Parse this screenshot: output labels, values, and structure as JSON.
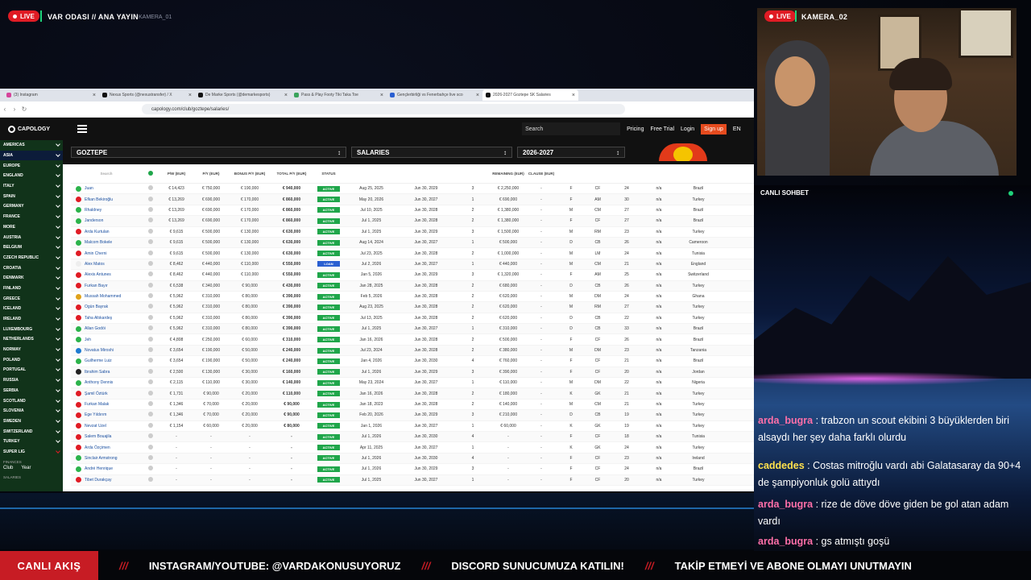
{
  "header": {
    "live": "LIVE",
    "title": "VAR ODASI // ANA YAYIN",
    "sub": "KAMERA_01"
  },
  "cam": {
    "live": "LIVE",
    "title": "KAMERA_02"
  },
  "browser": {
    "tabs": [
      {
        "label": "(3) Instagram",
        "color": "#d6449b"
      },
      {
        "label": "Nexus Sports (@nexustransfer) / X",
        "color": "#111"
      },
      {
        "label": "De Marke Sports (@demarkesports)",
        "color": "#111"
      },
      {
        "label": "Pass & Play Footy Tiki Taka Toe",
        "color": "#3aa35c"
      },
      {
        "label": "Gençlerbirliği vs Fenerbahçe live sco",
        "color": "#2a5fd1"
      },
      {
        "label": "2026-2027 Goztepe SK Salaries",
        "color": "#111"
      }
    ],
    "url": "capology.com/club/goztepe/salaries/"
  },
  "site": {
    "logo": "CAPOLOGY",
    "search": "Search",
    "nav": [
      "Pricing",
      "Free Trial",
      "Login"
    ],
    "signup": "Sign up",
    "lang": "EN"
  },
  "side": {
    "regions": [
      "AMERICAS",
      "ASIA",
      "EUROPE",
      "ENGLAND",
      "ITALY",
      "SPAIN",
      "GERMANY",
      "FRANCE",
      "MORE",
      "AUSTRIA",
      "BELGIUM",
      "CZECH REPUBLIC",
      "CROATIA",
      "DENMARK",
      "FINLAND",
      "GREECE",
      "ICELAND",
      "IRELAND",
      "LUXEMBOURG",
      "NETHERLANDS",
      "NORWAY",
      "POLAND",
      "PORTUGAL",
      "RUSSIA",
      "SERBIA",
      "SCOTLAND",
      "SLOVENIA",
      "SWEDEN",
      "SWITZERLAND",
      "TURKEY",
      "SUPER LIG"
    ],
    "finances": "FINANCES",
    "club": "Club",
    "year": "Year",
    "salaries": "SALARIES"
  },
  "filters": {
    "club": "GOZTEPE",
    "type": "SALARIES",
    "season": "2026-2027"
  },
  "columns": [
    "P/W (EUR)",
    "P/Y (EUR)",
    "BONUS P/Y (EUR)",
    "TOTAL P/Y (EUR)",
    "STATUS",
    "",
    "",
    "",
    "REMAINING (EUR)",
    "CLAUSE (EUR)",
    "",
    "",
    "",
    "",
    ""
  ],
  "search_placeholder": "Search",
  "rows": [
    [
      "Juan",
      "€ 14,423",
      "€ 750,000",
      "€ 190,000",
      "€ 940,000",
      "ACTIVE",
      "Aug 25, 2025",
      "Jun 30, 2029",
      "3",
      "€ 2,250,000",
      "-",
      "F",
      "CF",
      "24",
      "n/a",
      "Brazil"
    ],
    [
      "Efkan Bekiroğlu",
      "€ 13,269",
      "€ 690,000",
      "€ 170,000",
      "€ 860,000",
      "ACTIVE",
      "May 20, 2026",
      "Jun 30, 2027",
      "1",
      "€ 690,000",
      "-",
      "F",
      "AM",
      "30",
      "n/a",
      "Turkey"
    ],
    [
      "Rhaldney",
      "€ 13,269",
      "€ 690,000",
      "€ 170,000",
      "€ 860,000",
      "ACTIVE",
      "Jul 10, 2025",
      "Jun 30, 2028",
      "2",
      "€ 1,380,000",
      "-",
      "M",
      "CM",
      "27",
      "n/a",
      "Brazil"
    ],
    [
      "Janderson",
      "€ 13,269",
      "€ 690,000",
      "€ 170,000",
      "€ 860,000",
      "ACTIVE",
      "Jul 1, 2025",
      "Jun 30, 2028",
      "2",
      "€ 1,380,000",
      "-",
      "F",
      "CF",
      "27",
      "n/a",
      "Brazil"
    ],
    [
      "Arda Kurtulan",
      "€ 9,615",
      "€ 500,000",
      "€ 130,000",
      "€ 630,000",
      "ACTIVE",
      "Jul 1, 2025",
      "Jun 30, 2029",
      "3",
      "€ 1,500,000",
      "-",
      "M",
      "RM",
      "23",
      "n/a",
      "Turkey"
    ],
    [
      "Malcom Bokele",
      "€ 9,615",
      "€ 500,000",
      "€ 130,000",
      "€ 630,000",
      "ACTIVE",
      "Aug 14, 2024",
      "Jun 30, 2027",
      "1",
      "€ 500,000",
      "-",
      "D",
      "CB",
      "26",
      "n/a",
      "Cameroon"
    ],
    [
      "Amin Cherni",
      "€ 9,615",
      "€ 500,000",
      "€ 130,000",
      "€ 630,000",
      "ACTIVE",
      "Jul 23, 2025",
      "Jun 30, 2028",
      "2",
      "€ 1,000,000",
      "-",
      "M",
      "LM",
      "24",
      "n/a",
      "Tunisia"
    ],
    [
      "Alex Matos",
      "€ 8,462",
      "€ 440,000",
      "€ 110,000",
      "€ 550,000",
      "LOAN",
      "Jul 2, 2026",
      "Jun 30, 2027",
      "1",
      "€ 440,000",
      "-",
      "M",
      "CM",
      "21",
      "n/a",
      "England"
    ],
    [
      "Alexis Antunes",
      "€ 8,462",
      "€ 440,000",
      "€ 110,000",
      "€ 550,000",
      "ACTIVE",
      "Jan 5, 2026",
      "Jun 30, 2029",
      "3",
      "€ 1,320,000",
      "-",
      "F",
      "AM",
      "25",
      "n/a",
      "Switzerland"
    ],
    [
      "Furkan Bayır",
      "€ 6,538",
      "€ 340,000",
      "€ 90,000",
      "€ 430,000",
      "ACTIVE",
      "Jan 28, 2025",
      "Jun 30, 2028",
      "2",
      "€ 680,000",
      "-",
      "D",
      "CB",
      "26",
      "n/a",
      "Turkey"
    ],
    [
      "Mussah Mohammed",
      "€ 5,962",
      "€ 310,000",
      "€ 80,000",
      "€ 390,000",
      "ACTIVE",
      "Feb 5, 2026",
      "Jun 30, 2028",
      "2",
      "€ 620,000",
      "-",
      "M",
      "DM",
      "24",
      "n/a",
      "Ghana"
    ],
    [
      "Ogün Bayrak",
      "€ 5,962",
      "€ 310,000",
      "€ 80,000",
      "€ 390,000",
      "ACTIVE",
      "Aug 23, 2025",
      "Jun 30, 2028",
      "2",
      "€ 620,000",
      "-",
      "M",
      "RM",
      "27",
      "n/a",
      "Turkey"
    ],
    [
      "Taha Altıkardeş",
      "€ 5,962",
      "€ 310,000",
      "€ 80,000",
      "€ 390,000",
      "ACTIVE",
      "Jul 13, 2025",
      "Jun 30, 2028",
      "2",
      "€ 620,000",
      "-",
      "D",
      "CB",
      "22",
      "n/a",
      "Turkey"
    ],
    [
      "Allan Godói",
      "€ 5,962",
      "€ 310,000",
      "€ 80,000",
      "€ 390,000",
      "ACTIVE",
      "Jul 1, 2025",
      "Jun 30, 2027",
      "1",
      "€ 310,000",
      "-",
      "D",
      "CB",
      "33",
      "n/a",
      "Brazil"
    ],
    [
      "Jeh",
      "€ 4,808",
      "€ 250,000",
      "€ 60,000",
      "€ 310,000",
      "ACTIVE",
      "Jan 16, 2026",
      "Jun 30, 2028",
      "2",
      "€ 500,000",
      "-",
      "F",
      "CF",
      "26",
      "n/a",
      "Brazil"
    ],
    [
      "Novatus Miroshi",
      "€ 3,654",
      "€ 190,000",
      "€ 50,000",
      "€ 240,000",
      "ACTIVE",
      "Jul 23, 2024",
      "Jun 30, 2028",
      "2",
      "€ 380,000",
      "-",
      "M",
      "DM",
      "23",
      "n/a",
      "Tanzania"
    ],
    [
      "Guilherme Luiz",
      "€ 3,654",
      "€ 190,000",
      "€ 50,000",
      "€ 240,000",
      "ACTIVE",
      "Jan 4, 2026",
      "Jun 30, 2030",
      "4",
      "€ 760,000",
      "-",
      "F",
      "CF",
      "21",
      "n/a",
      "Brazil"
    ],
    [
      "Ibrahim Sabra",
      "€ 2,500",
      "€ 130,000",
      "€ 30,000",
      "€ 160,000",
      "ACTIVE",
      "Jul 1, 2026",
      "Jun 30, 2029",
      "3",
      "€ 390,000",
      "-",
      "F",
      "CF",
      "20",
      "n/a",
      "Jordan"
    ],
    [
      "Anthony Dennis",
      "€ 2,115",
      "€ 110,000",
      "€ 30,000",
      "€ 140,000",
      "ACTIVE",
      "May 23, 2024",
      "Jun 30, 2027",
      "1",
      "€ 110,000",
      "-",
      "M",
      "DM",
      "22",
      "n/a",
      "Nigeria"
    ],
    [
      "Şamil Öztürk",
      "€ 1,731",
      "€ 90,000",
      "€ 20,000",
      "€ 110,000",
      "ACTIVE",
      "Jan 16, 2026",
      "Jun 30, 2028",
      "2",
      "€ 180,000",
      "-",
      "K",
      "GK",
      "21",
      "n/a",
      "Turkey"
    ],
    [
      "Furkan Malak",
      "€ 1,346",
      "€ 70,000",
      "€ 20,000",
      "€ 90,000",
      "ACTIVE",
      "Jan 18, 2023",
      "Jun 30, 2028",
      "2",
      "€ 140,000",
      "-",
      "M",
      "CM",
      "21",
      "n/a",
      "Turkey"
    ],
    [
      "Ege Yıldırım",
      "€ 1,346",
      "€ 70,000",
      "€ 20,000",
      "€ 90,000",
      "ACTIVE",
      "Feb 20, 2026",
      "Jun 30, 2029",
      "3",
      "€ 210,000",
      "-",
      "D",
      "CB",
      "19",
      "n/a",
      "Turkey"
    ],
    [
      "Nevzat Uzel",
      "€ 1,154",
      "€ 60,000",
      "€ 20,000",
      "€ 80,000",
      "ACTIVE",
      "Jan 1, 2026",
      "Jun 30, 2027",
      "1",
      "€ 60,000",
      "-",
      "K",
      "GK",
      "19",
      "n/a",
      "Turkey"
    ],
    [
      "Salem Bouajila",
      "-",
      "-",
      "-",
      "-",
      "ACTIVE",
      "Jul 1, 2026",
      "Jun 30, 2030",
      "4",
      "-",
      "-",
      "F",
      "CF",
      "18",
      "n/a",
      "Tunisia"
    ],
    [
      "Arda Özçimen",
      "-",
      "-",
      "-",
      "-",
      "ACTIVE",
      "Apr 11, 2025",
      "Jun 30, 2027",
      "1",
      "-",
      "-",
      "K",
      "GK",
      "24",
      "n/a",
      "Turkey"
    ],
    [
      "Sinclair Armstrong",
      "-",
      "-",
      "-",
      "-",
      "ACTIVE",
      "Jul 1, 2026",
      "Jun 30, 2030",
      "4",
      "-",
      "-",
      "F",
      "CF",
      "23",
      "n/a",
      "Ireland"
    ],
    [
      "André Henrique",
      "-",
      "-",
      "-",
      "-",
      "ACTIVE",
      "Jul 1, 2026",
      "Jun 30, 2029",
      "3",
      "-",
      "-",
      "F",
      "CF",
      "24",
      "n/a",
      "Brazil"
    ],
    [
      "Tibet Durakçay",
      "-",
      "-",
      "-",
      "-",
      "ACTIVE",
      "Jul 1, 2025",
      "Jun 30, 2027",
      "1",
      "-",
      "-",
      "F",
      "CF",
      "20",
      "n/a",
      "Turkey"
    ]
  ],
  "chat": {
    "title": "CANLI SOHBET",
    "messages": [
      {
        "user": "arda_bugra",
        "color": "#ff6fa8",
        "text": " : trabzon un scout ekibini 3 büyüklerden biri alsaydı her şey daha farklı olurdu"
      },
      {
        "user": "caddedes",
        "color": "#ffe14d",
        "text": " : Costas mitroğlu vardı abi Galatasaray da 90+4 de şampiyonluk golü attıydı"
      },
      {
        "user": "arda_bugra",
        "color": "#ff6fa8",
        "text": " : rize de döve döve giden be gol atan adam vardı"
      },
      {
        "user": "arda_bugra",
        "color": "#ff6fa8",
        "text": " : gs atmıştı goşü"
      }
    ]
  },
  "ticker": {
    "label": "CANLI AKIŞ",
    "sep": "///",
    "items": [
      "INSTAGRAM/YOUTUBE: @VARDAKONUSUYORUZ",
      "DISCORD SUNUCUMUZA KATILIN!",
      "TAKİP ETMEYİ VE ABONE OLMAYI UNUTMAYIN"
    ]
  }
}
